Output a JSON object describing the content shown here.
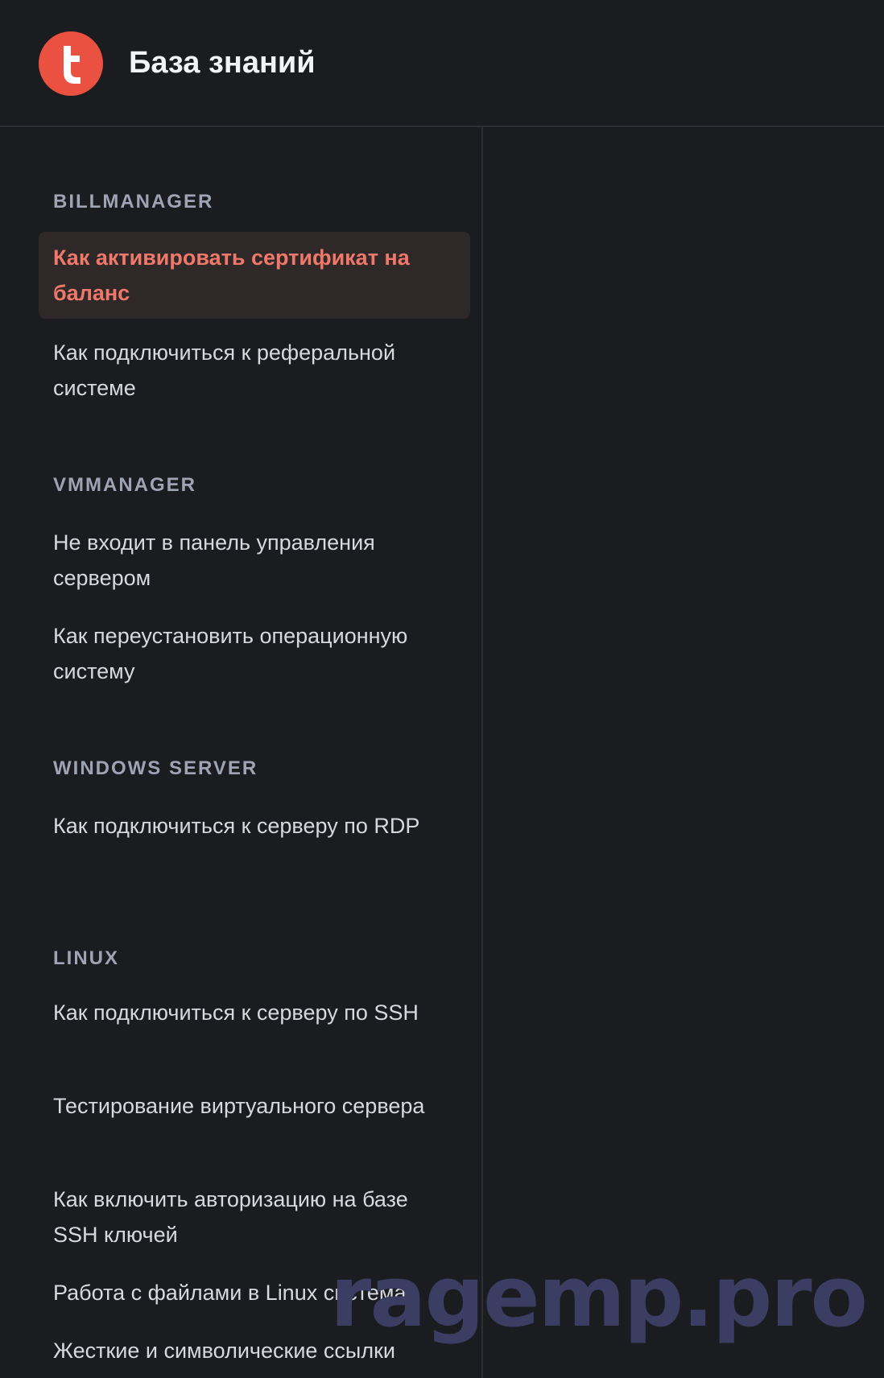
{
  "header": {
    "logo_icon": "t-letter-logo-icon",
    "logo_color": "#ea5141",
    "title": "База знаний"
  },
  "sidebar": {
    "sections": [
      {
        "heading": "BILLMANAGER",
        "items": [
          {
            "label": "Как активировать сертификат на баланс",
            "active": true
          },
          {
            "label": "Как подключиться к реферальной системе",
            "active": false
          }
        ]
      },
      {
        "heading": "VMMANAGER",
        "items": [
          {
            "label": "Не входит в панель управления сервером",
            "active": false
          },
          {
            "label": "Как переустановить операционную систему",
            "active": false
          }
        ]
      },
      {
        "heading": "WINDOWS SERVER",
        "items": [
          {
            "label": "Как подключиться к серверу по RDP",
            "active": false
          }
        ]
      },
      {
        "heading": "LINUX",
        "items": [
          {
            "label": "Как подключиться к серверу по SSH",
            "active": false
          },
          {
            "label": "Тестирование виртуального сервера",
            "active": false
          },
          {
            "label": "Как включить авторизацию на базе SSH ключей",
            "active": false
          },
          {
            "label": "Работа с файлами в Linux системах",
            "active": false
          },
          {
            "label": "Жесткие и символические ссылки",
            "active": false
          }
        ]
      }
    ]
  },
  "colors": {
    "background": "#1a1c20",
    "accent": "#ea5141",
    "active_text": "#f0786a",
    "active_bg": "#2e2828",
    "heading": "#9fa3b3"
  },
  "watermark": "ragemp.pro"
}
